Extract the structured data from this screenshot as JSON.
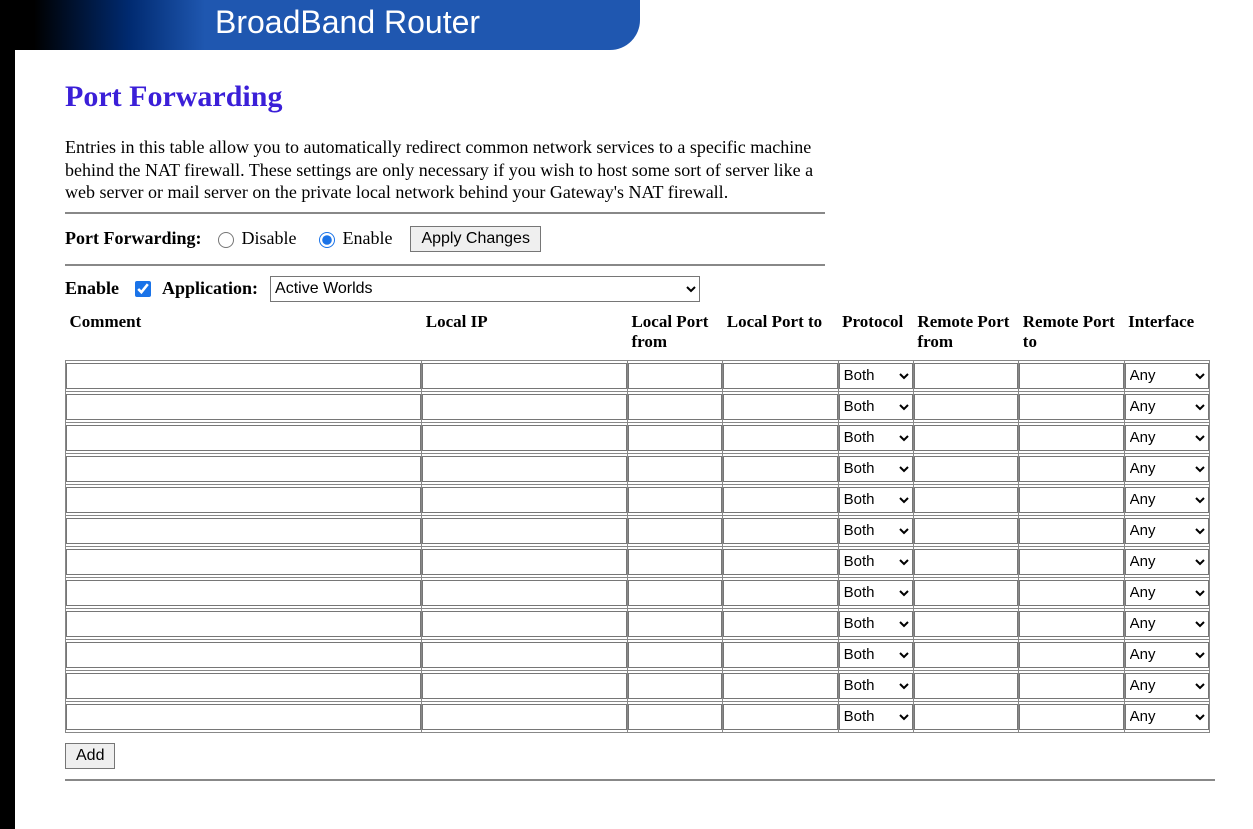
{
  "banner": {
    "title": "BroadBand Router"
  },
  "page": {
    "title": "Port Forwarding",
    "description": "Entries in this table allow you to automatically redirect common network services to a specific machine behind the NAT firewall. These settings are only necessary if you wish to host some sort of server like a web server or mail server on the private local network behind your Gateway's NAT firewall."
  },
  "toggle": {
    "label": "Port Forwarding:",
    "disable_label": "Disable",
    "enable_label": "Enable",
    "value": "enable",
    "apply_button": "Apply Changes"
  },
  "enable_app": {
    "enable_label": "Enable",
    "enable_checked": true,
    "application_label": "Application:",
    "application_value": "Active Worlds"
  },
  "columns": {
    "comment": "Comment",
    "local_ip": "Local IP",
    "local_port_from": "Local Port from",
    "local_port_to": "Local Port to",
    "protocol": "Protocol",
    "remote_port_from": "Remote Port from",
    "remote_port_to": "Remote Port to",
    "interface": "Interface"
  },
  "defaults": {
    "protocol": "Both",
    "interface": "Any"
  },
  "rows": [
    {
      "comment": "",
      "local_ip": "",
      "local_port_from": "",
      "local_port_to": "",
      "protocol": "Both",
      "remote_port_from": "",
      "remote_port_to": "",
      "interface": "Any"
    },
    {
      "comment": "",
      "local_ip": "",
      "local_port_from": "",
      "local_port_to": "",
      "protocol": "Both",
      "remote_port_from": "",
      "remote_port_to": "",
      "interface": "Any"
    },
    {
      "comment": "",
      "local_ip": "",
      "local_port_from": "",
      "local_port_to": "",
      "protocol": "Both",
      "remote_port_from": "",
      "remote_port_to": "",
      "interface": "Any"
    },
    {
      "comment": "",
      "local_ip": "",
      "local_port_from": "",
      "local_port_to": "",
      "protocol": "Both",
      "remote_port_from": "",
      "remote_port_to": "",
      "interface": "Any"
    },
    {
      "comment": "",
      "local_ip": "",
      "local_port_from": "",
      "local_port_to": "",
      "protocol": "Both",
      "remote_port_from": "",
      "remote_port_to": "",
      "interface": "Any"
    },
    {
      "comment": "",
      "local_ip": "",
      "local_port_from": "",
      "local_port_to": "",
      "protocol": "Both",
      "remote_port_from": "",
      "remote_port_to": "",
      "interface": "Any"
    },
    {
      "comment": "",
      "local_ip": "",
      "local_port_from": "",
      "local_port_to": "",
      "protocol": "Both",
      "remote_port_from": "",
      "remote_port_to": "",
      "interface": "Any"
    },
    {
      "comment": "",
      "local_ip": "",
      "local_port_from": "",
      "local_port_to": "",
      "protocol": "Both",
      "remote_port_from": "",
      "remote_port_to": "",
      "interface": "Any"
    },
    {
      "comment": "",
      "local_ip": "",
      "local_port_from": "",
      "local_port_to": "",
      "protocol": "Both",
      "remote_port_from": "",
      "remote_port_to": "",
      "interface": "Any"
    },
    {
      "comment": "",
      "local_ip": "",
      "local_port_from": "",
      "local_port_to": "",
      "protocol": "Both",
      "remote_port_from": "",
      "remote_port_to": "",
      "interface": "Any"
    },
    {
      "comment": "",
      "local_ip": "",
      "local_port_from": "",
      "local_port_to": "",
      "protocol": "Both",
      "remote_port_from": "",
      "remote_port_to": "",
      "interface": "Any"
    },
    {
      "comment": "",
      "local_ip": "",
      "local_port_from": "",
      "local_port_to": "",
      "protocol": "Both",
      "remote_port_from": "",
      "remote_port_to": "",
      "interface": "Any"
    }
  ],
  "buttons": {
    "add": "Add"
  }
}
